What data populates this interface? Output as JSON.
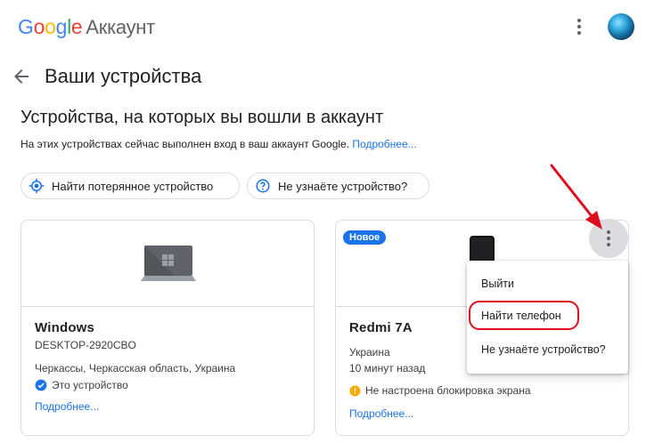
{
  "header": {
    "logo_g": "G",
    "logo_o1": "o",
    "logo_o2": "o",
    "logo_g2": "g",
    "logo_l": "l",
    "logo_e": "e",
    "account_label": "Аккаунт"
  },
  "page": {
    "title": "Ваши устройства",
    "section_title": "Устройства, на которых вы вошли в аккаунт",
    "section_subtitle": "На этих устройствах сейчас выполнен вход в ваш аккаунт Google.",
    "more_link": "Подробнее..."
  },
  "chips": {
    "find_device": "Найти потерянное устройство",
    "unknown_device": "Не узнаёте устройство?"
  },
  "cards": [
    {
      "name": "Windows",
      "hostname": "DESKTOP-2920CBO",
      "location": "Черкассы, Черкасская область, Украина",
      "this_device": "Это устройство",
      "more_link": "Подробнее..."
    },
    {
      "badge": "Новое",
      "name": "Redmi 7A",
      "location": "Украина",
      "last_seen": "10 минут назад",
      "warning": "Не настроена блокировка экрана",
      "more_link": "Подробнее..."
    }
  ],
  "menu": {
    "items": [
      "Выйти",
      "Найти телефон",
      "Не узнаёте устройство?"
    ]
  },
  "colors": {
    "accent": "#1a73e8",
    "annotation_red": "#e00b1c",
    "warning": "#f9ab00"
  },
  "icons": [
    "menu-dots-icon",
    "avatar",
    "back-arrow-icon",
    "locate-icon",
    "help-icon",
    "laptop-icon",
    "phone-icon",
    "check-badge-icon",
    "warning-icon"
  ]
}
